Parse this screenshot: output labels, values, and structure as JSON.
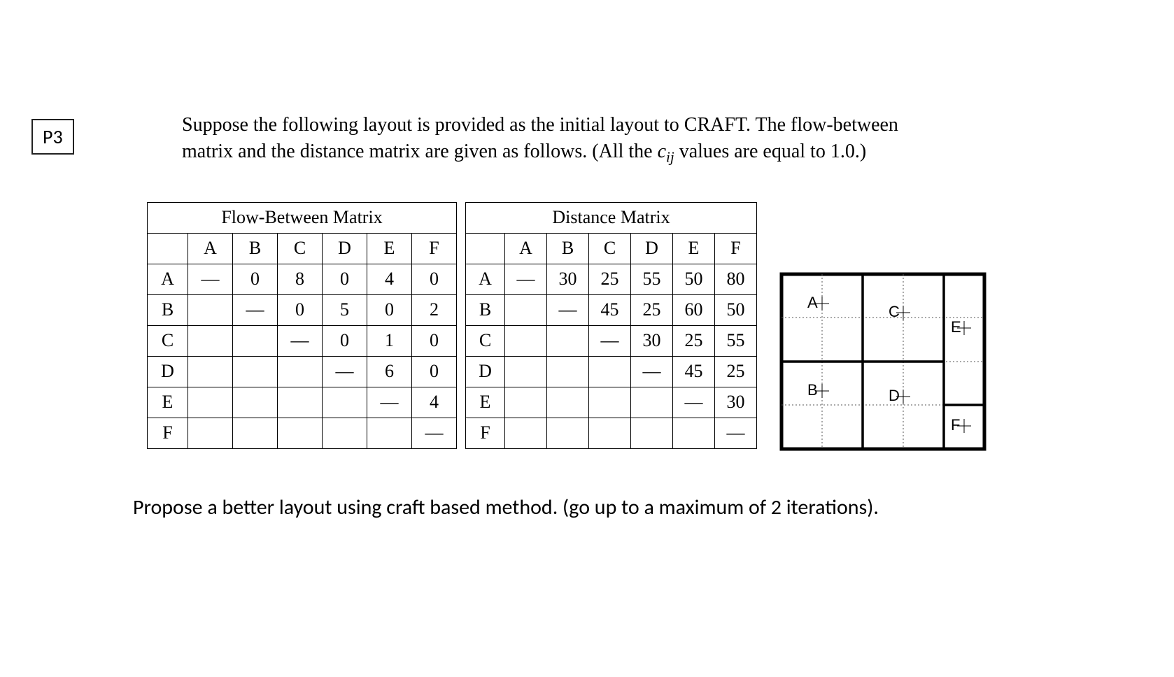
{
  "label": "P3",
  "problem_text_1": "Suppose the following layout is provided as the initial layout to CRAFT. The flow-between",
  "problem_text_2a": "matrix and the distance matrix are given as follows. (All the ",
  "problem_text_2b": " values are equal to 1.0.)",
  "c_var": "c",
  "c_sub": "ij",
  "flow_title": "Flow-Between Matrix",
  "dist_title": "Distance Matrix",
  "cols": [
    "A",
    "B",
    "C",
    "D",
    "E",
    "F"
  ],
  "rows": [
    "A",
    "B",
    "C",
    "D",
    "E",
    "F"
  ],
  "flow": [
    [
      "—",
      "0",
      "8",
      "0",
      "4",
      "0"
    ],
    [
      "",
      "—",
      "0",
      "5",
      "0",
      "2"
    ],
    [
      "",
      "",
      "—",
      "0",
      "1",
      "0"
    ],
    [
      "",
      "",
      "",
      "—",
      "6",
      "0"
    ],
    [
      "",
      "",
      "",
      "",
      "—",
      "4"
    ],
    [
      "",
      "",
      "",
      "",
      "",
      "—"
    ]
  ],
  "dist": [
    [
      "—",
      "30",
      "25",
      "55",
      "50",
      "80"
    ],
    [
      "",
      "—",
      "45",
      "25",
      "60",
      "50"
    ],
    [
      "",
      "",
      "—",
      "30",
      "25",
      "55"
    ],
    [
      "",
      "",
      "",
      "—",
      "45",
      "25"
    ],
    [
      "",
      "",
      "",
      "",
      "—",
      "30"
    ],
    [
      "",
      "",
      "",
      "",
      "",
      "—"
    ]
  ],
  "layout_labels": {
    "A": "A",
    "B": "B",
    "C": "C",
    "D": "D",
    "E": "E",
    "F": "F"
  },
  "instruction": "Propose a better layout using craft based method. (go up to a maximum of 2 iterations)."
}
